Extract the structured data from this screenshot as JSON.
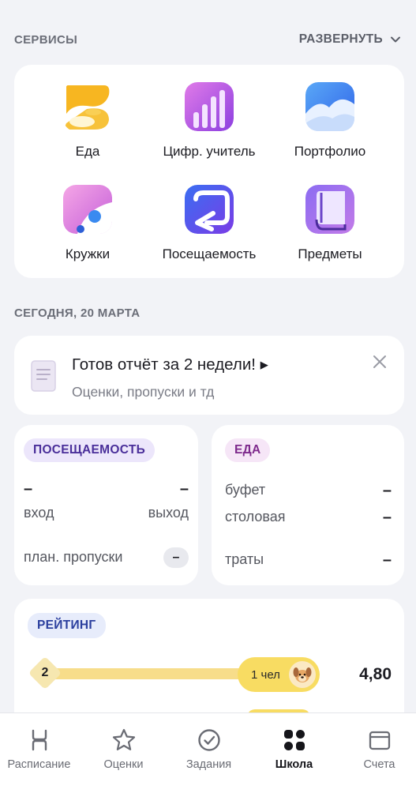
{
  "services_section": {
    "title": "СЕРВИСЫ",
    "expand_label": "РАЗВЕРНУТЬ",
    "items": [
      {
        "label": "Еда",
        "icon": "food-icon"
      },
      {
        "label": "Цифр. учитель",
        "icon": "digital-teacher-icon"
      },
      {
        "label": "Портфолио",
        "icon": "portfolio-icon"
      },
      {
        "label": "Кружки",
        "icon": "clubs-icon"
      },
      {
        "label": "Посещаемость",
        "icon": "attendance-icon"
      },
      {
        "label": "Предметы",
        "icon": "subjects-icon"
      }
    ]
  },
  "today": {
    "date_label": "СЕГОДНЯ, 20 МАРТА"
  },
  "report": {
    "title": "Готов отчёт за 2 недели! ▸",
    "subtitle": "Оценки, пропуски и тд"
  },
  "attendance": {
    "badge": "ПОСЕЩАЕМОСТЬ",
    "entry_value": "–",
    "exit_value": "–",
    "entry_label": "вход",
    "exit_label": "выход",
    "planned_absences_label": "план. пропуски",
    "planned_absences_value": "–"
  },
  "food": {
    "badge": "ЕДА",
    "rows": [
      {
        "label": "буфет",
        "value": "–"
      },
      {
        "label": "столовая",
        "value": "–"
      },
      {
        "label": "траты",
        "value": "–"
      }
    ]
  },
  "rating": {
    "badge": "РЕЙТИНГ",
    "place": "2",
    "people_count": "1 чел",
    "score": "4,80"
  },
  "tabbar": {
    "tabs": [
      {
        "label": "Расписание",
        "icon": "schedule-icon"
      },
      {
        "label": "Оценки",
        "icon": "star-icon"
      },
      {
        "label": "Задания",
        "icon": "check-circle-icon"
      },
      {
        "label": "Школа",
        "icon": "grid-icon",
        "active": true
      },
      {
        "label": "Счета",
        "icon": "wallet-icon"
      }
    ]
  },
  "colors": {
    "background": "#f2f3f7",
    "card": "#ffffff",
    "rating_bar": "#f7dd8a",
    "rating_pill": "#f8dc62"
  }
}
